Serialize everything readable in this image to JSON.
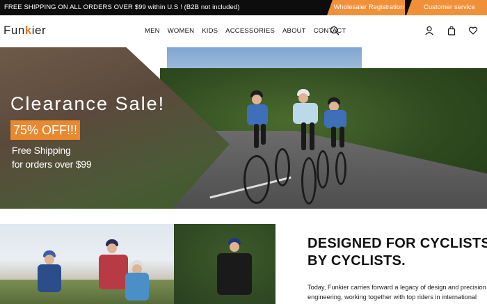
{
  "promo": {
    "text": "FREE SHIPPING ON ALL ORDERS OVER $99 within U.S ! (B2B not included)",
    "wholesaler_label": "Wholesaler Registration",
    "service_label": "Customer service"
  },
  "header": {
    "logo_prefix": "Fun",
    "logo_k": "k",
    "logo_suffix": "ier",
    "nav": [
      "MEN",
      "WOMEN",
      "KIDS",
      "ACCESSORIES",
      "ABOUT",
      "CONTACT"
    ],
    "icons": [
      "search-icon",
      "user-icon",
      "bag-icon",
      "heart-icon"
    ]
  },
  "hero": {
    "title": "Clearance Sale!",
    "badge": "75% OFF!!!",
    "line1": "Free Shipping",
    "line2": "for orders over $99"
  },
  "section": {
    "title_line1": "DESIGNED FOR CYCLISTS,",
    "title_line2": "BY CYCLISTS.",
    "body_line1": "Today, Funkier carries forward a legacy of design and precision",
    "body_line2": "engineering, working together with top riders in international"
  },
  "colors": {
    "accent": "#f0913a",
    "promo_bg": "#0d0d0d",
    "badge": "#e8892f"
  }
}
